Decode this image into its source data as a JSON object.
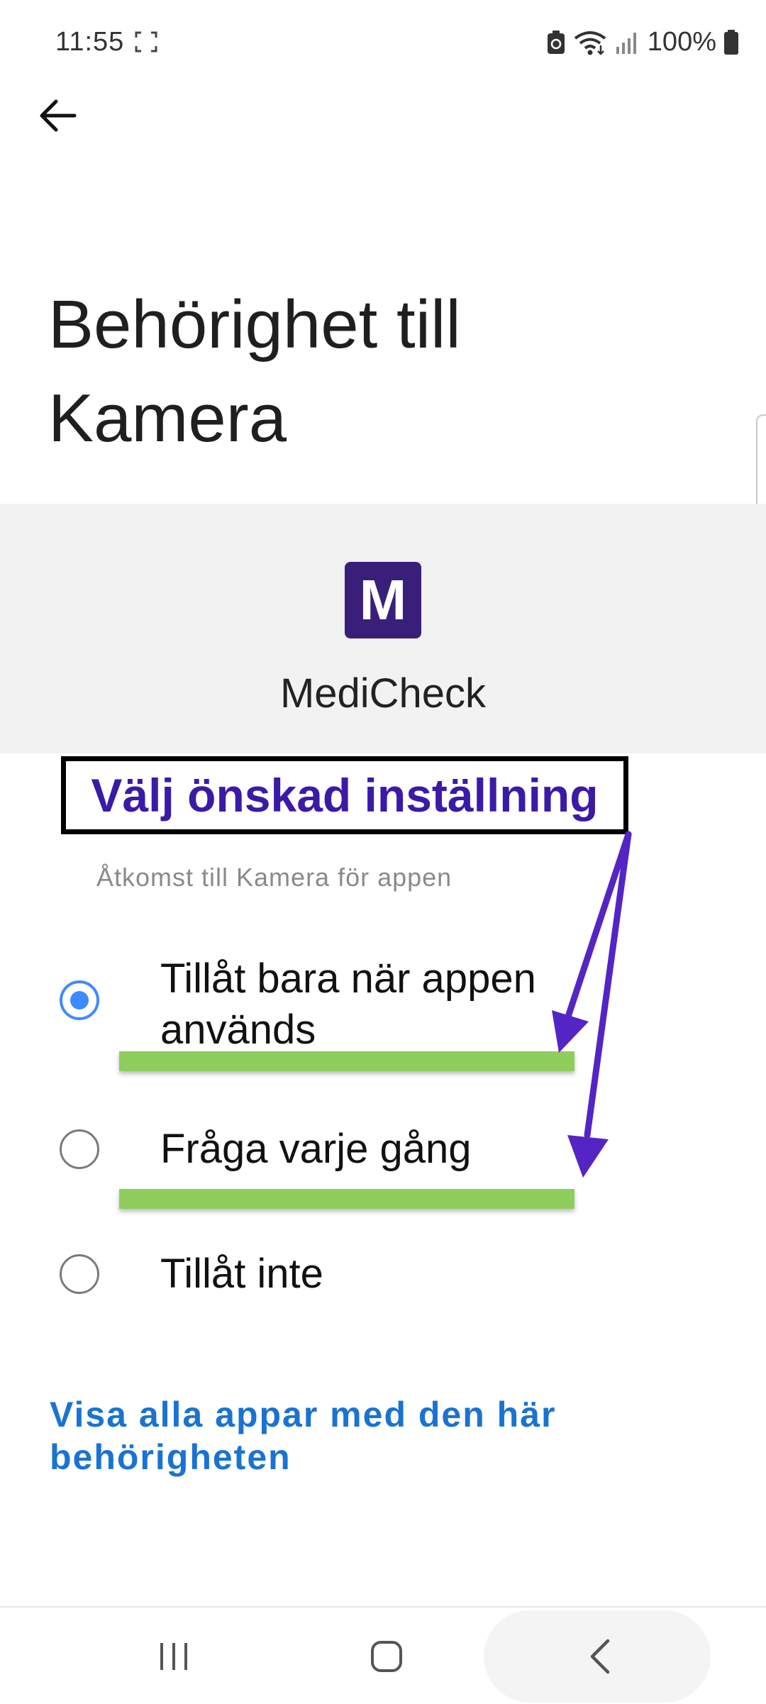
{
  "status_bar": {
    "time": "11:55",
    "battery_percent": "100%"
  },
  "page": {
    "title_line1": "Behörighet till",
    "title_line2": "Kamera"
  },
  "app": {
    "icon_letter": "M",
    "name": "MediCheck",
    "icon_color": "#3a1f7a"
  },
  "annotation": {
    "label": "Välj önskad inställning",
    "text_color": "#3b1aa8",
    "arrow_color": "#5524c5",
    "highlight_color": "#8fce5d"
  },
  "section": {
    "subheading": "Åtkomst till Kamera för appen"
  },
  "options": [
    {
      "label_line1": "Tillåt bara när appen",
      "label_line2": "används",
      "selected": true
    },
    {
      "label": "Fråga varje gång",
      "selected": false
    },
    {
      "label": "Tillåt inte",
      "selected": false
    }
  ],
  "link": {
    "line1": "Visa alla appar med den här",
    "line2": "behörigheten",
    "color": "#1a73d1"
  }
}
